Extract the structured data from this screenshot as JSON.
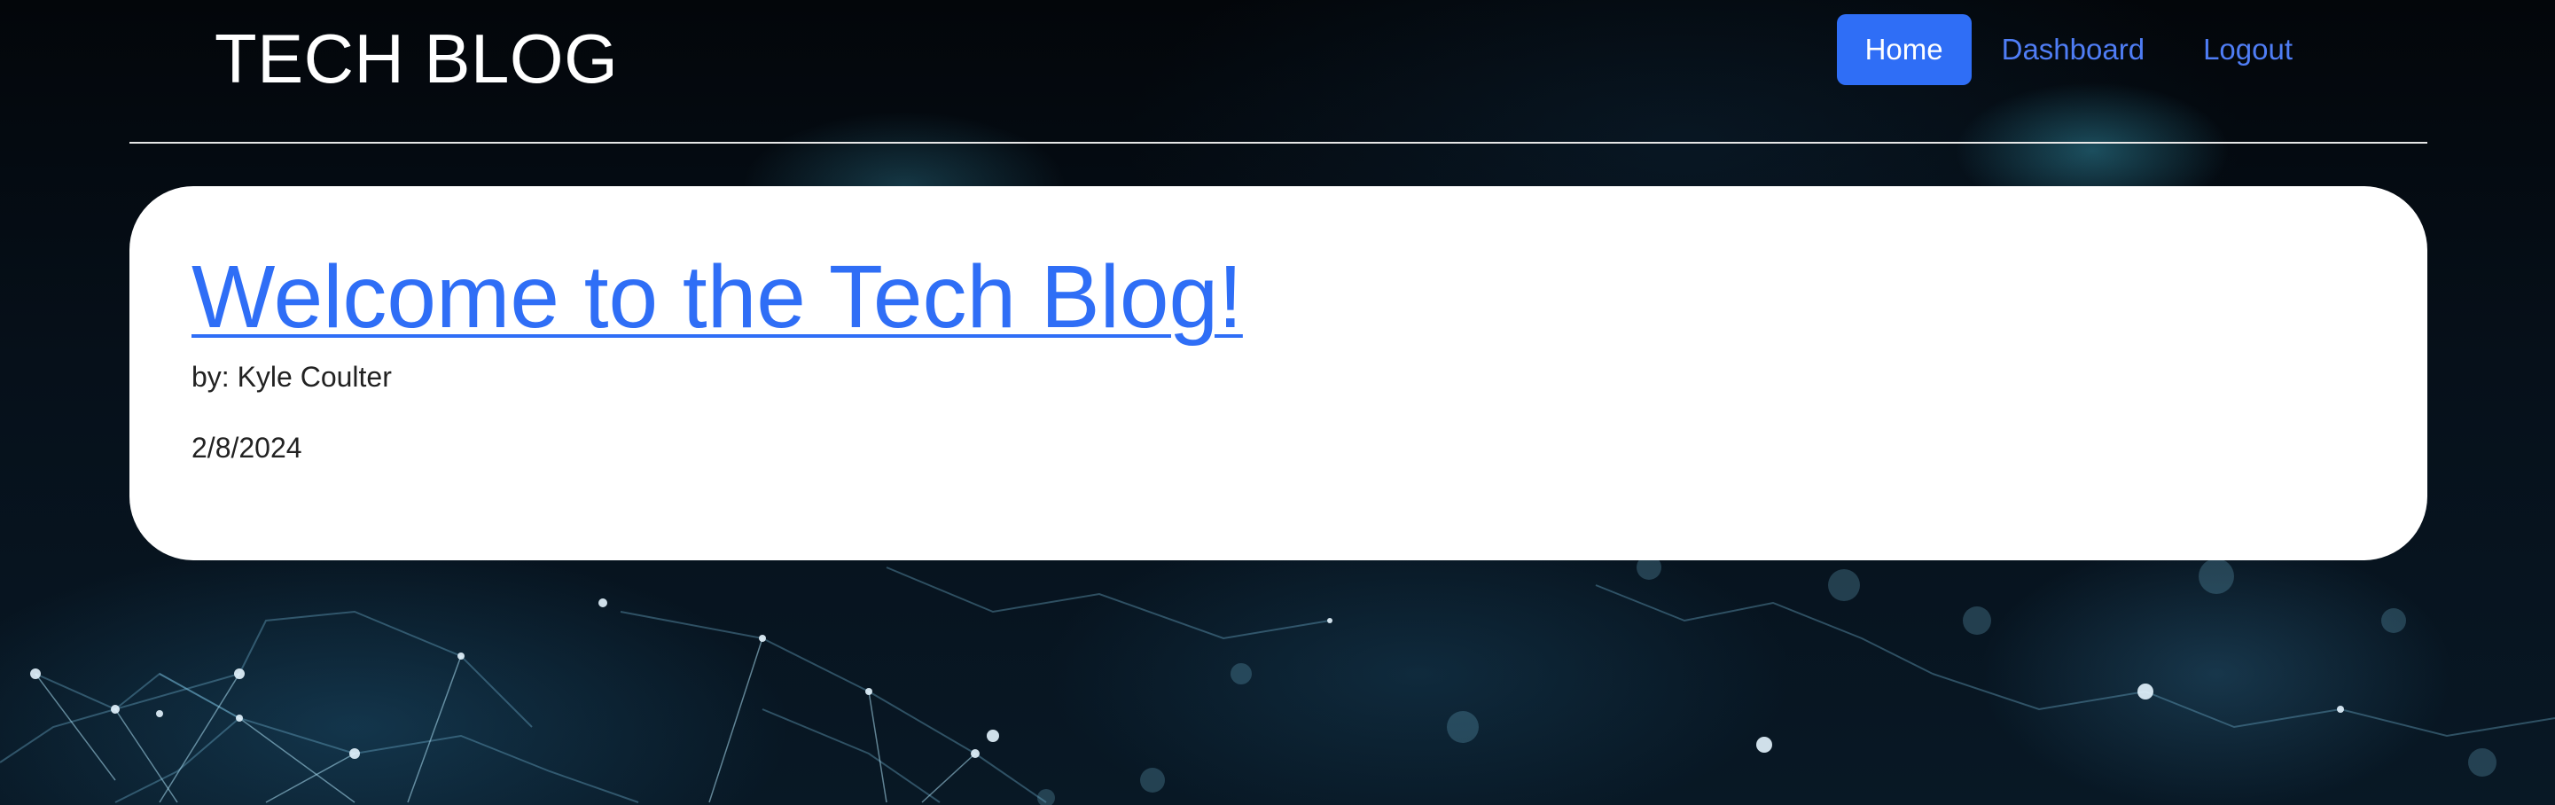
{
  "header": {
    "brand": "TECH BLOG",
    "nav": {
      "home_label": "Home",
      "dashboard_label": "Dashboard",
      "logout_label": "Logout",
      "active": "Home"
    }
  },
  "posts": [
    {
      "title": "Welcome to the Tech Blog!",
      "byline": "by: Kyle Coulter",
      "date": "2/8/2024"
    }
  ],
  "colors": {
    "accent": "#2f6ef6",
    "link": "#4f7df5",
    "card_bg": "#ffffff",
    "page_bg": "#04070c"
  }
}
